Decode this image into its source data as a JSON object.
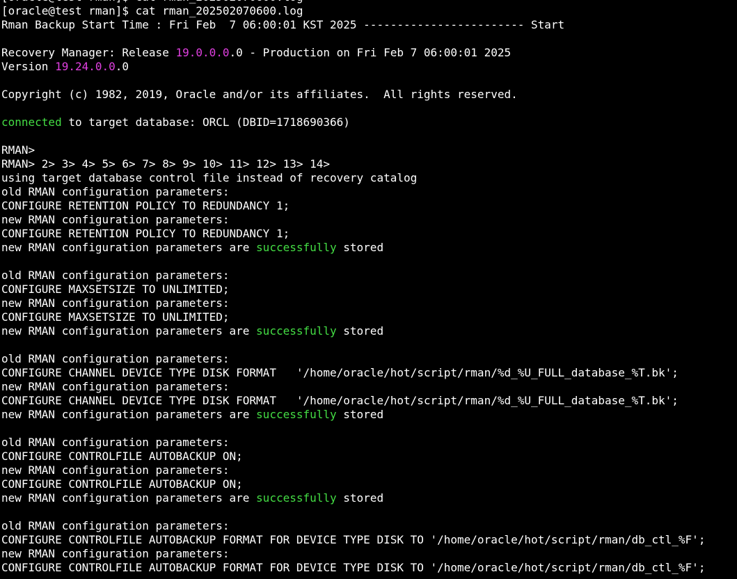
{
  "colors": {
    "background": "#000000",
    "foreground": "#ffffff",
    "version_highlight": "#e040e0",
    "success_highlight": "#44dd44"
  },
  "terminal": {
    "lines": [
      [
        {
          "text": "[oracle@test rman]$ cat rman_202502070600.log",
          "color": "white"
        }
      ],
      [
        {
          "text": "[oracle@test rman]$ cat rman_202502070600.log",
          "color": "white"
        }
      ],
      [
        {
          "text": "Rman Backup Start Time : Fri Feb  7 06:00:01 KST 2025 ------------------------ Start",
          "color": "white"
        }
      ],
      [
        {
          "text": "",
          "color": "white"
        }
      ],
      [
        {
          "text": "Recovery Manager: Release ",
          "color": "white"
        },
        {
          "text": "19.0.0.0",
          "color": "magenta"
        },
        {
          "text": ".0 - Production on Fri Feb 7 06:00:01 2025",
          "color": "white"
        }
      ],
      [
        {
          "text": "Version ",
          "color": "white"
        },
        {
          "text": "19.24.0.0",
          "color": "magenta"
        },
        {
          "text": ".0",
          "color": "white"
        }
      ],
      [
        {
          "text": "",
          "color": "white"
        }
      ],
      [
        {
          "text": "Copyright (c) 1982, 2019, Oracle and/or its affiliates.  All rights reserved.",
          "color": "white"
        }
      ],
      [
        {
          "text": "",
          "color": "white"
        }
      ],
      [
        {
          "text": "connected",
          "color": "green"
        },
        {
          "text": " to target database: ORCL (DBID=1718690366)",
          "color": "white"
        }
      ],
      [
        {
          "text": "",
          "color": "white"
        }
      ],
      [
        {
          "text": "RMAN>",
          "color": "white"
        }
      ],
      [
        {
          "text": "RMAN> 2> 3> 4> 5> 6> 7> 8> 9> 10> 11> 12> 13> 14>",
          "color": "white"
        }
      ],
      [
        {
          "text": "using target database control file instead of recovery catalog",
          "color": "white"
        }
      ],
      [
        {
          "text": "old RMAN configuration parameters:",
          "color": "white"
        }
      ],
      [
        {
          "text": "CONFIGURE RETENTION POLICY TO REDUNDANCY 1;",
          "color": "white"
        }
      ],
      [
        {
          "text": "new RMAN configuration parameters:",
          "color": "white"
        }
      ],
      [
        {
          "text": "CONFIGURE RETENTION POLICY TO REDUNDANCY 1;",
          "color": "white"
        }
      ],
      [
        {
          "text": "new RMAN configuration parameters are ",
          "color": "white"
        },
        {
          "text": "successfully",
          "color": "green"
        },
        {
          "text": " stored",
          "color": "white"
        }
      ],
      [
        {
          "text": "",
          "color": "white"
        }
      ],
      [
        {
          "text": "old RMAN configuration parameters:",
          "color": "white"
        }
      ],
      [
        {
          "text": "CONFIGURE MAXSETSIZE TO UNLIMITED;",
          "color": "white"
        }
      ],
      [
        {
          "text": "new RMAN configuration parameters:",
          "color": "white"
        }
      ],
      [
        {
          "text": "CONFIGURE MAXSETSIZE TO UNLIMITED;",
          "color": "white"
        }
      ],
      [
        {
          "text": "new RMAN configuration parameters are ",
          "color": "white"
        },
        {
          "text": "successfully",
          "color": "green"
        },
        {
          "text": " stored",
          "color": "white"
        }
      ],
      [
        {
          "text": "",
          "color": "white"
        }
      ],
      [
        {
          "text": "old RMAN configuration parameters:",
          "color": "white"
        }
      ],
      [
        {
          "text": "CONFIGURE CHANNEL DEVICE TYPE DISK FORMAT   '/home/oracle/hot/script/rman/%d_%U_FULL_database_%T.bk';",
          "color": "white"
        }
      ],
      [
        {
          "text": "new RMAN configuration parameters:",
          "color": "white"
        }
      ],
      [
        {
          "text": "CONFIGURE CHANNEL DEVICE TYPE DISK FORMAT   '/home/oracle/hot/script/rman/%d_%U_FULL_database_%T.bk';",
          "color": "white"
        }
      ],
      [
        {
          "text": "new RMAN configuration parameters are ",
          "color": "white"
        },
        {
          "text": "successfully",
          "color": "green"
        },
        {
          "text": " stored",
          "color": "white"
        }
      ],
      [
        {
          "text": "",
          "color": "white"
        }
      ],
      [
        {
          "text": "old RMAN configuration parameters:",
          "color": "white"
        }
      ],
      [
        {
          "text": "CONFIGURE CONTROLFILE AUTOBACKUP ON;",
          "color": "white"
        }
      ],
      [
        {
          "text": "new RMAN configuration parameters:",
          "color": "white"
        }
      ],
      [
        {
          "text": "CONFIGURE CONTROLFILE AUTOBACKUP ON;",
          "color": "white"
        }
      ],
      [
        {
          "text": "new RMAN configuration parameters are ",
          "color": "white"
        },
        {
          "text": "successfully",
          "color": "green"
        },
        {
          "text": " stored",
          "color": "white"
        }
      ],
      [
        {
          "text": "",
          "color": "white"
        }
      ],
      [
        {
          "text": "old RMAN configuration parameters:",
          "color": "white"
        }
      ],
      [
        {
          "text": "CONFIGURE CONTROLFILE AUTOBACKUP FORMAT FOR DEVICE TYPE DISK TO '/home/oracle/hot/script/rman/db_ctl_%F';",
          "color": "white"
        }
      ],
      [
        {
          "text": "new RMAN configuration parameters:",
          "color": "white"
        }
      ],
      [
        {
          "text": "CONFIGURE CONTROLFILE AUTOBACKUP FORMAT FOR DEVICE TYPE DISK TO '/home/oracle/hot/script/rman/db_ctl_%F';",
          "color": "white"
        }
      ]
    ]
  }
}
